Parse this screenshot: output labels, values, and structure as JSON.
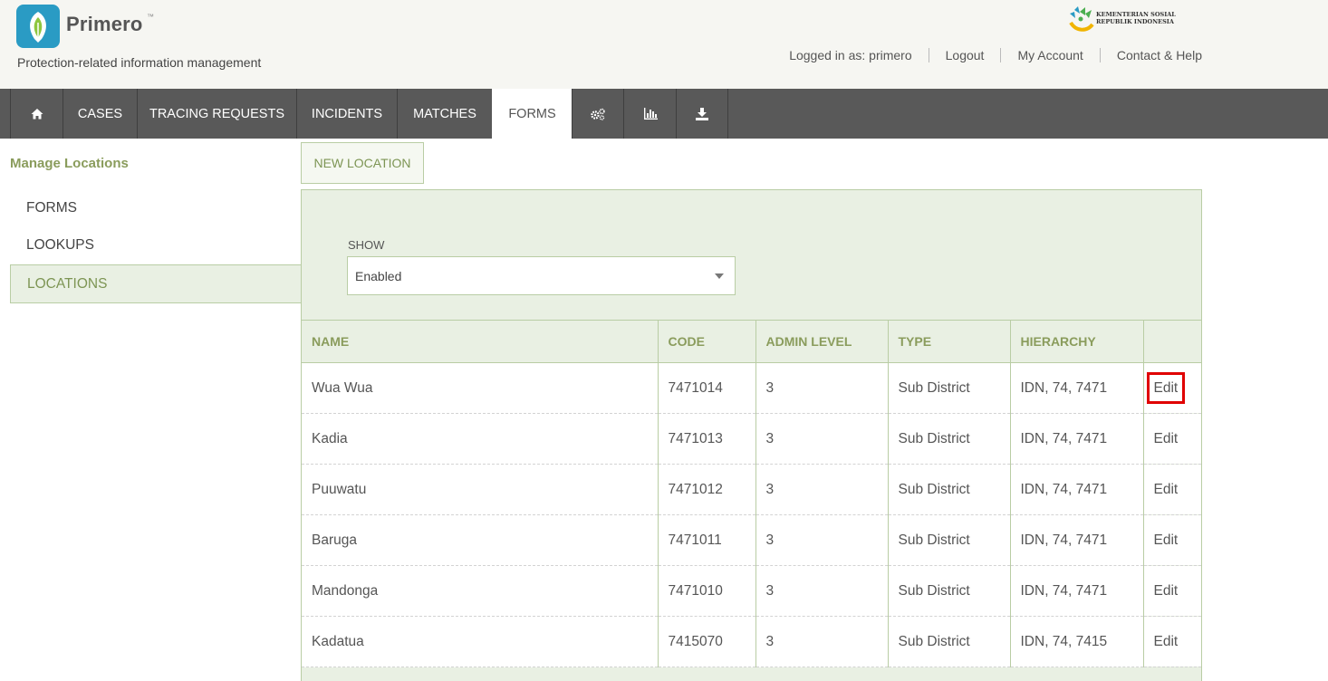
{
  "header": {
    "app_name": "Primero",
    "trademark": "™",
    "tagline": "Protection-related information management",
    "ministry_logo_text": "KEMENTERIAN SOSIAL\nREPUBLIK INDONESIA",
    "user_links": {
      "logged_in": "Logged in as: primero",
      "logout": "Logout",
      "my_account": "My Account",
      "contact_help": "Contact & Help"
    }
  },
  "nav": {
    "home_icon": "home-icon",
    "items": [
      "CASES",
      "TRACING REQUESTS",
      "INCIDENTS",
      "MATCHES",
      "FORMS"
    ],
    "active": "FORMS",
    "settings_icon": "gears-icon",
    "reports_icon": "bar-chart-icon",
    "export_icon": "download-icon"
  },
  "sidebar": {
    "title": "Manage Locations",
    "items": [
      "FORMS",
      "LOOKUPS",
      "LOCATIONS"
    ],
    "active": "LOCATIONS"
  },
  "main": {
    "new_button": "NEW LOCATION",
    "show_label": "SHOW",
    "show_value": "Enabled",
    "table": {
      "headers": [
        "NAME",
        "CODE",
        "ADMIN LEVEL",
        "TYPE",
        "HIERARCHY",
        ""
      ],
      "rows": [
        [
          "Wua Wua",
          "7471014",
          "3",
          "Sub District",
          "IDN, 74, 7471",
          "Edit"
        ],
        [
          "Kadia",
          "7471013",
          "3",
          "Sub District",
          "IDN, 74, 7471",
          "Edit"
        ],
        [
          "Puuwatu",
          "7471012",
          "3",
          "Sub District",
          "IDN, 74, 7471",
          "Edit"
        ],
        [
          "Baruga",
          "7471011",
          "3",
          "Sub District",
          "IDN, 74, 7471",
          "Edit"
        ],
        [
          "Mandonga",
          "7471010",
          "3",
          "Sub District",
          "IDN, 74, 7471",
          "Edit"
        ],
        [
          "Kadatua",
          "7415070",
          "3",
          "Sub District",
          "IDN, 74, 7415",
          "Edit"
        ]
      ]
    }
  },
  "colors": {
    "accent_green": "#8a9c5c",
    "panel_green": "#e9f0e3",
    "nav_bg": "#595959",
    "logo_blue": "#2a9bc4",
    "highlight_red": "#e00000"
  }
}
